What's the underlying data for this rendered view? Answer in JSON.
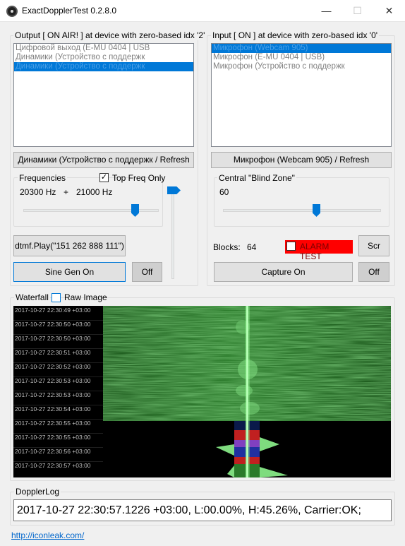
{
  "window": {
    "title": "ExactDopplerTest 0.2.8.0",
    "minimize_glyph": "—",
    "maximize_glyph": "☐",
    "close_glyph": "✕"
  },
  "output": {
    "group_label": "Output [ ON AIR! ] at device with zero-based idx '2'",
    "devices": [
      "Цифровой выход (E-MU 0404 | USB",
      "Динамики (Устройство с поддержк",
      "Динамики (Устройство с поддержк"
    ],
    "selected_index": 2,
    "refresh_button": "Динамики (Устройство с поддержк / Refresh"
  },
  "input": {
    "group_label": "Input [ ON ] at device with zero-based idx '0'",
    "devices": [
      "Микрофон (Webcam 905)",
      "Микрофон (E-MU 0404 | USB)",
      "Микрофон (Устройство с поддержк"
    ],
    "selected_index": 0,
    "refresh_button": "Микрофон (Webcam 905) / Refresh"
  },
  "frequencies": {
    "group_label": "Frequencies",
    "top_freq_only_label": "Top Freq Only",
    "top_freq_only_checked": true,
    "freq1": "20300 Hz",
    "plus": "+",
    "freq2": "21000 Hz",
    "slider_fraction": 0.86,
    "vertical_slider_fraction": 1.0
  },
  "blind_zone": {
    "group_label": "Central \"Blind Zone\"",
    "value": "60",
    "slider_fraction": 0.6
  },
  "dtmf_button": "dtmf.Play(\"151 262 888 111\")",
  "sine_gen_button": "Sine Gen On",
  "sine_off_button": "Off",
  "blocks_label": "Blocks:",
  "blocks_value": "64",
  "alarm_test_label": "ALARM TEST",
  "alarm_color": "#ff0000",
  "scr_button": "Scr",
  "capture_button": "Capture On",
  "capture_off_button": "Off",
  "waterfall": {
    "group_label": "Waterfall",
    "raw_image_label": "Raw Image",
    "raw_image_checked": false,
    "timestamps": [
      "2017-10-27 22:30:49 +03:00",
      "2017-10-27 22:30:50 +03:00",
      "2017-10-27 22:30:50 +03:00",
      "2017-10-27 22:30:51 +03:00",
      "2017-10-27 22:30:52 +03:00",
      "2017-10-27 22:30:53 +03:00",
      "2017-10-27 22:30:53 +03:00",
      "2017-10-27 22:30:54 +03:00",
      "2017-10-27 22:30:55 +03:00",
      "2017-10-27 22:30:55 +03:00",
      "2017-10-27 22:30:56 +03:00",
      "2017-10-27 22:30:57 +03:00"
    ]
  },
  "doppler_log": {
    "group_label": "DopplerLog",
    "text": "2017-10-27 22:30:57.1226 +03:00, L:00.00%, H:45.26%, Carrier:OK;"
  },
  "link_text": "http://iconleak.com/"
}
